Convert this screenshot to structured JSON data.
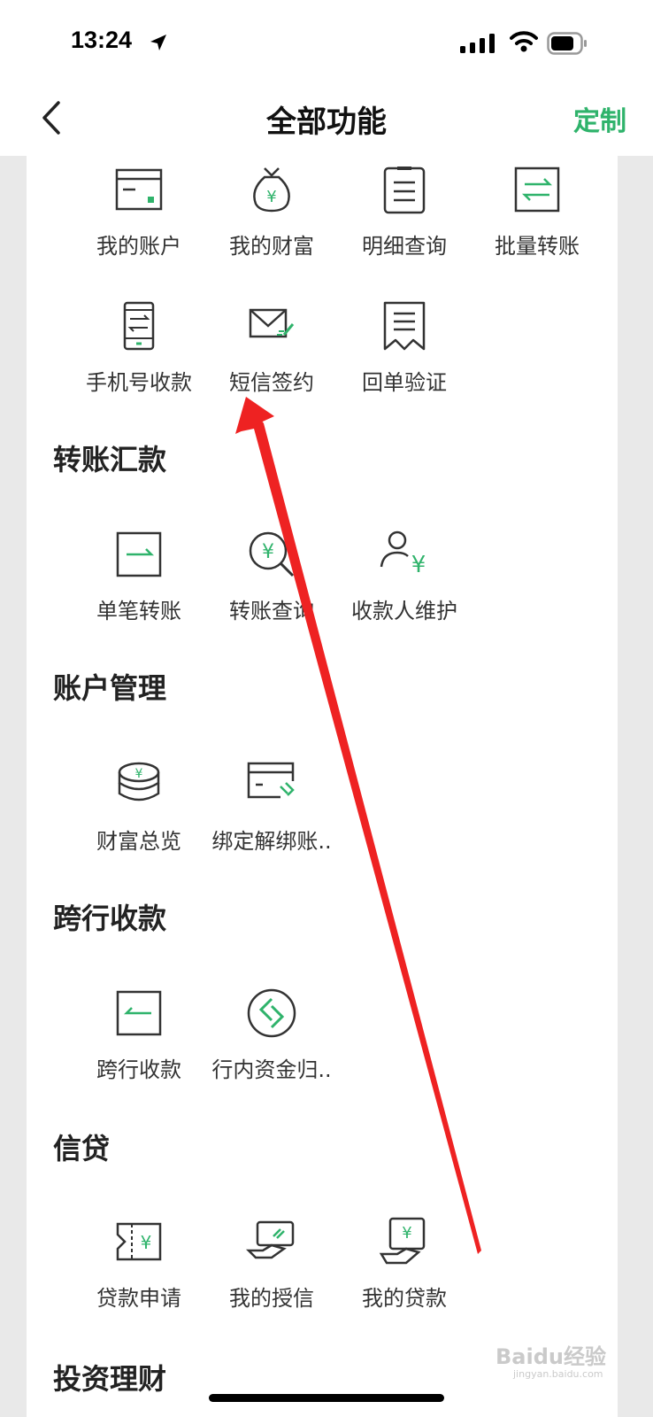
{
  "status": {
    "time": "13:24"
  },
  "nav": {
    "title": "全部功能",
    "customize": "定制"
  },
  "top_items": [
    {
      "label": "我的账户",
      "icon": "account-card-icon"
    },
    {
      "label": "我的财富",
      "icon": "money-bag-icon"
    },
    {
      "label": "明细查询",
      "icon": "clipboard-icon"
    },
    {
      "label": "批量转账",
      "icon": "batch-transfer-icon"
    },
    {
      "label": "手机号收款",
      "icon": "phone-transfer-icon"
    },
    {
      "label": "短信签约",
      "icon": "sms-envelope-icon"
    },
    {
      "label": "回单验证",
      "icon": "receipt-icon"
    }
  ],
  "sections": [
    {
      "title": "转账汇款",
      "items": [
        {
          "label": "单笔转账",
          "icon": "single-transfer-icon"
        },
        {
          "label": "转账查询",
          "icon": "yuan-search-icon"
        },
        {
          "label": "收款人维护",
          "icon": "payee-icon"
        }
      ]
    },
    {
      "title": "账户管理",
      "items": [
        {
          "label": "财富总览",
          "icon": "coin-stack-icon"
        },
        {
          "label": "绑定解绑账..",
          "icon": "card-link-icon"
        }
      ]
    },
    {
      "title": "跨行收款",
      "items": [
        {
          "label": "跨行收款",
          "icon": "interbank-icon"
        },
        {
          "label": "行内资金归..",
          "icon": "fund-collect-icon"
        }
      ]
    },
    {
      "title": "信贷",
      "items": [
        {
          "label": "贷款申请",
          "icon": "loan-apply-icon"
        },
        {
          "label": "我的授信",
          "icon": "credit-icon"
        },
        {
          "label": "我的贷款",
          "icon": "my-loan-icon"
        }
      ]
    },
    {
      "title": "投资理财",
      "items": []
    }
  ],
  "watermark": {
    "text": "Baidu经验",
    "sub": "jingyan.baidu.com"
  },
  "colors": {
    "accent": "#2fb36b",
    "icon_stroke": "#333333",
    "arrow": "#ee2222"
  }
}
